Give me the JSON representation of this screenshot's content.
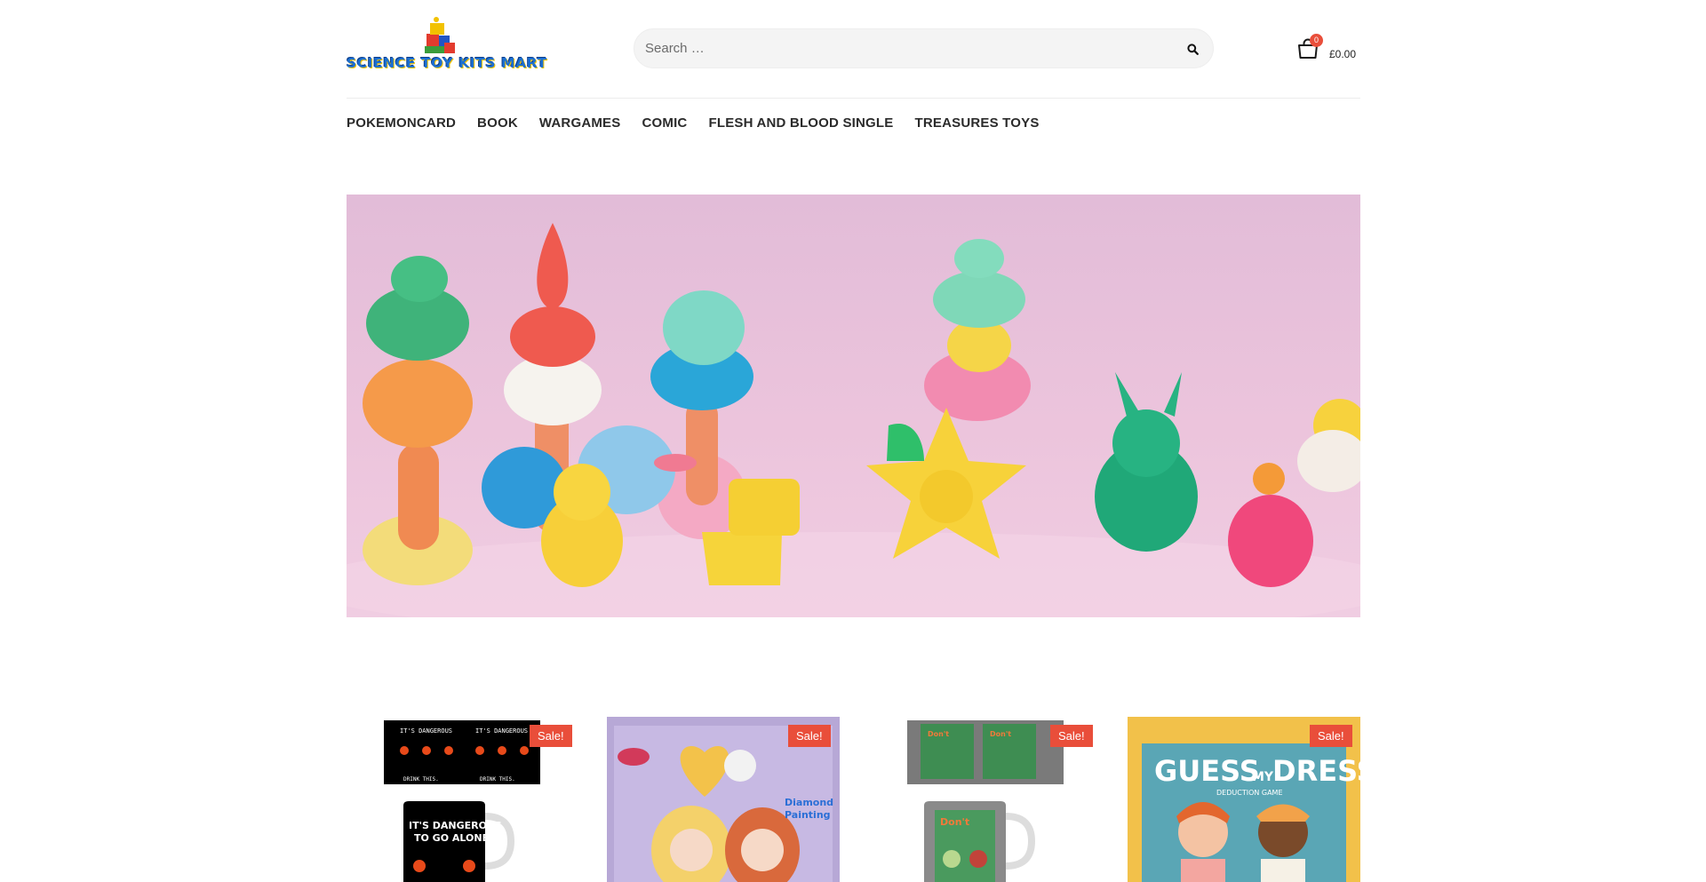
{
  "site": {
    "logo_text": "SCIENCE TOY KITS MART"
  },
  "search": {
    "placeholder": "Search …",
    "icon": "search-icon"
  },
  "cart": {
    "count": "0",
    "total": "£0.00",
    "icon": "shopping-bag-icon"
  },
  "nav": {
    "items": [
      {
        "label": "POKEMONCARD"
      },
      {
        "label": "BOOK"
      },
      {
        "label": "WARGAMES"
      },
      {
        "label": "COMIC"
      },
      {
        "label": "FLESH AND BLOOD SINGLE"
      },
      {
        "label": "TREASURES TOYS"
      }
    ]
  },
  "hero": {
    "image": "clay-toys-banner"
  },
  "products": [
    {
      "badge": "Sale!",
      "image": "zelda-its-dangerous-to-go-alone-mug",
      "mug_text_top": "IT'S DANGEROUS TO GO ALONE!",
      "mug_text_bottom": "DRINK THIS."
    },
    {
      "badge": "Sale!",
      "image": "diamond-painting-kit-box",
      "box_text": "Diamond Painting"
    },
    {
      "badge": "Sale!",
      "image": "dont-talk-to-strangers-mug"
    },
    {
      "badge": "Sale!",
      "image": "guess-my-dress-game-box",
      "box_title": "GUESS MY DRESS",
      "box_subtitle": "DEDUCTION GAME"
    }
  ],
  "colors": {
    "accent": "#e94e3a",
    "nav_text": "#2b2b2b",
    "search_bg": "#f4f4f4"
  }
}
